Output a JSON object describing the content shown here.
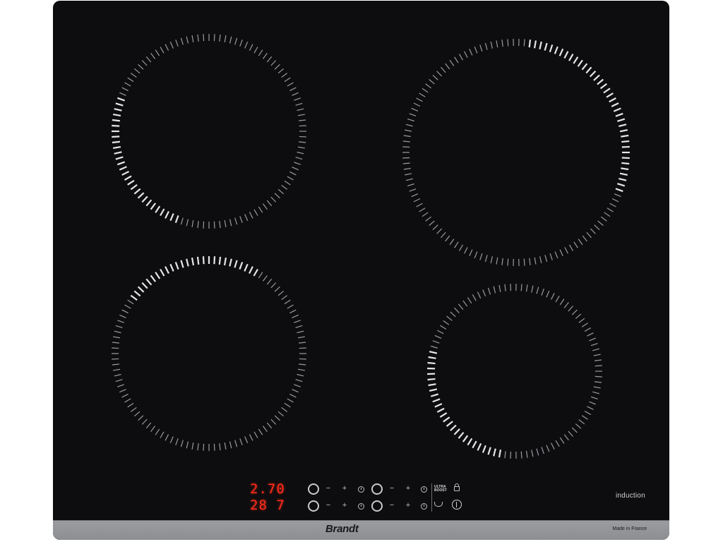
{
  "product": {
    "brand": "Brandt",
    "made_in": "Made in France",
    "type_label": "induction"
  },
  "displays": {
    "top": "2.70",
    "bottom": "28 7"
  },
  "controls": {
    "minus": "−",
    "plus": "+",
    "ultra_boost_line1": "ULTRA",
    "ultra_boost_line2": "BOOST"
  },
  "icons": {
    "lock": "lock-icon",
    "power": "power-icon",
    "timer": "timer-icon",
    "keep_warm": "keep-warm-icon",
    "zone_knob": "zone-selector-icon"
  },
  "colors": {
    "glass": "#0d0d0f",
    "frame": "#8e9094",
    "zone_ticks": "#9a9ba0",
    "zone_ticks_bright": "#e6e6e8",
    "display_red": "#ff2a1a",
    "text_light": "#cfd0d2"
  },
  "zones": [
    {
      "name": "front-left-zone",
      "highlight": [
        110,
        200
      ]
    },
    {
      "name": "rear-left-zone",
      "highlight": [
        215,
        300
      ]
    },
    {
      "name": "rear-right-zone",
      "highlight": [
        275,
        20
      ]
    },
    {
      "name": "front-right-zone",
      "highlight": [
        100,
        195
      ]
    }
  ]
}
